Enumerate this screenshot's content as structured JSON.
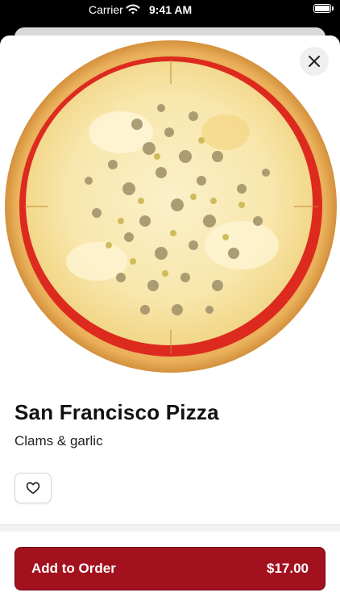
{
  "status_bar": {
    "carrier": "Carrier",
    "time": "9:41 AM"
  },
  "product": {
    "name": "San Francisco Pizza",
    "description": "Clams & garlic",
    "image_icon": "pizza-image"
  },
  "actions": {
    "close_icon": "close-icon",
    "favorite_icon": "heart-icon",
    "add_label": "Add to Order",
    "price": "$17.00"
  },
  "colors": {
    "accent": "#a3111e",
    "close_bg": "#efefef"
  }
}
